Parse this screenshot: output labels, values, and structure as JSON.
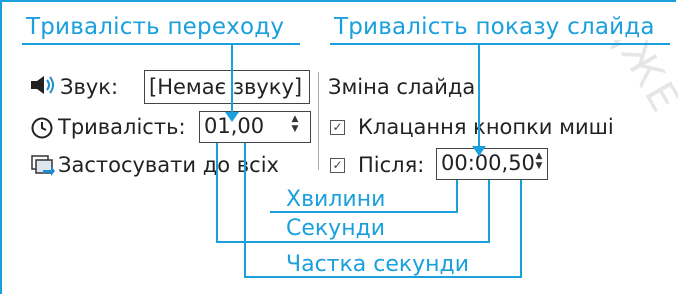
{
  "callouts": {
    "transition_duration": "Тривалість переходу",
    "slide_duration": "Тривалість показу слайда"
  },
  "panel": {
    "sound_label": "Звук:",
    "sound_value": "[Немає звуку]",
    "duration_label": "Тривалість:",
    "duration_value": "01,00",
    "apply_all_label": "Застосувати до всіх",
    "advance_heading": "Зміна слайда",
    "on_click_label": "Клацання кнопки миші",
    "after_label": "Після:",
    "after_value": "00:00,50"
  },
  "annotations": {
    "minutes": "Хвилини",
    "seconds": "Секунди",
    "fraction": "Частка секунди"
  },
  "colors": {
    "accent": "#1aa0dc"
  }
}
